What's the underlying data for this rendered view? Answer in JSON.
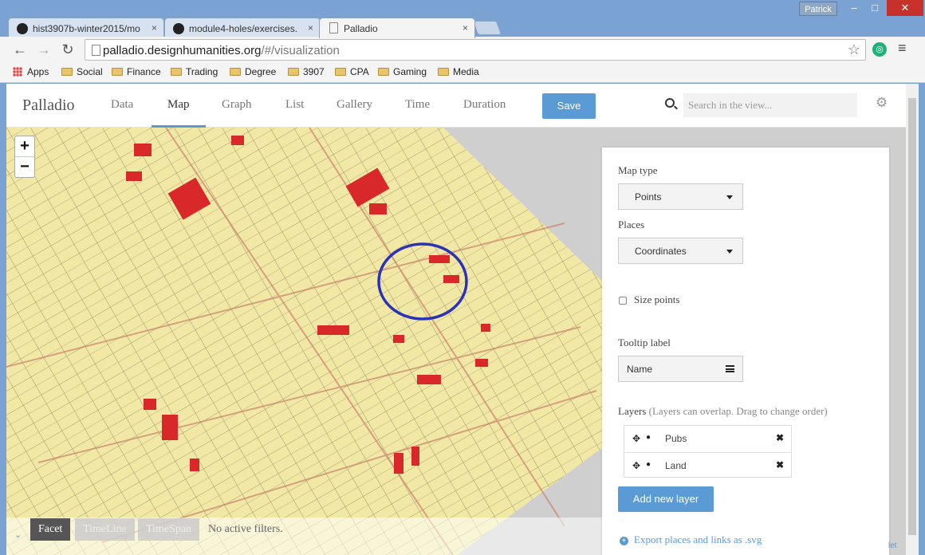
{
  "window": {
    "user": "Patrick",
    "min": "–",
    "max": "□",
    "close": "✕"
  },
  "tabs": [
    {
      "label": "hist3907b-winter2015/mo",
      "close": "×"
    },
    {
      "label": "module4-holes/exercises.",
      "close": "×"
    },
    {
      "label": "Palladio",
      "close": "×"
    }
  ],
  "toolbar": {
    "back": "←",
    "forward": "→",
    "reload": "↻",
    "url_host": "palladio.designhumanities.org",
    "url_path": "/#/visualization",
    "star": "☆",
    "ext": "◎",
    "menu": "≡"
  },
  "bookmarks": [
    "Apps",
    "Social",
    "Finance",
    "Trading",
    "Degree",
    "3907",
    "CPA",
    "Gaming",
    "Media"
  ],
  "app": {
    "brand": "Palladio",
    "nav": [
      "Data",
      "Map",
      "Graph",
      "List",
      "Gallery",
      "Time",
      "Duration"
    ],
    "active_nav": "Map",
    "save": "Save",
    "search_placeholder": "Search in the view...",
    "gear": "⚙"
  },
  "map": {
    "zoom_in": "+",
    "zoom_out": "−",
    "colors": {
      "paper": "#f2e8a6",
      "parcel": "#d8282a",
      "highlight": "#2a32b8",
      "water": "#cfcfcf"
    }
  },
  "filters": {
    "collapse": "⌄",
    "facet": "Facet",
    "timeline": "TimeLine",
    "timespan": "TimeSpan",
    "status": "No active filters."
  },
  "panel": {
    "map_type_label": "Map type",
    "map_type": "Points",
    "places_label": "Places",
    "places": "Coordinates",
    "size_points": "Size points",
    "tooltip_label": "Tooltip label",
    "tooltip": "Name",
    "layers_label": "Layers",
    "layers_hint": "(Layers can overlap. Drag to change order)",
    "layers": [
      {
        "name": "Pubs",
        "move": "✥",
        "eye": "●",
        "remove": "✖"
      },
      {
        "name": "Land",
        "move": "✥",
        "eye": "●",
        "remove": "✖"
      }
    ],
    "add_layer": "Add new layer",
    "export": "Export places and links as .svg"
  },
  "attribution": "let"
}
